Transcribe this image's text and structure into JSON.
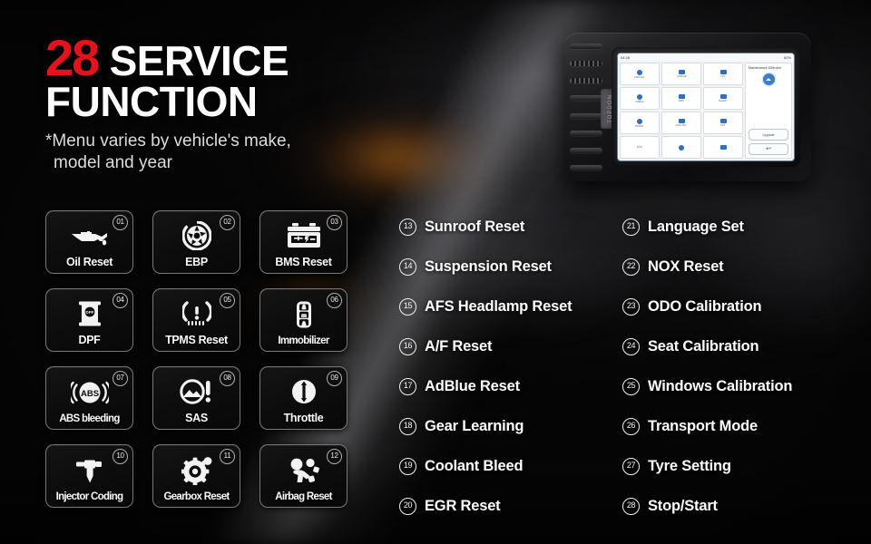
{
  "headline": {
    "count": "28",
    "title_part1": "SERVICE",
    "title_part2": "FUNCTION",
    "subtitle_line1": "*Menu varies by vehicle's make,",
    "subtitle_line2": "model and year",
    "accent_color": "#e4121a",
    "text_color": "#fdfdfd"
  },
  "cards": [
    {
      "num": "01",
      "label": "Oil Reset",
      "icon": "oil-can-icon"
    },
    {
      "num": "02",
      "label": "EBP",
      "icon": "brake-disc-icon"
    },
    {
      "num": "03",
      "label": "BMS Reset",
      "icon": "battery-icon"
    },
    {
      "num": "04",
      "label": "DPF",
      "icon": "dpf-filter-icon"
    },
    {
      "num": "05",
      "label": "TPMS Reset",
      "icon": "tire-pressure-icon"
    },
    {
      "num": "06",
      "label": "Immobilizer",
      "icon": "car-key-fob-icon"
    },
    {
      "num": "07",
      "label": "ABS bleeding",
      "icon": "abs-icon"
    },
    {
      "num": "08",
      "label": "SAS",
      "icon": "steering-angle-icon"
    },
    {
      "num": "09",
      "label": "Throttle",
      "icon": "throttle-icon"
    },
    {
      "num": "10",
      "label": "Injector Coding",
      "icon": "injector-icon"
    },
    {
      "num": "11",
      "label": "Gearbox Reset",
      "icon": "gear-icon"
    },
    {
      "num": "12",
      "label": "Airbag Reset",
      "icon": "airbag-icon"
    }
  ],
  "list_column_a": [
    {
      "num": "13",
      "label": "Sunroof Reset"
    },
    {
      "num": "14",
      "label": "Suspension Reset"
    },
    {
      "num": "15",
      "label": "AFS Headlamp Reset"
    },
    {
      "num": "16",
      "label": "A/F Reset"
    },
    {
      "num": "17",
      "label": "AdBlue Reset"
    },
    {
      "num": "18",
      "label": "Gear Learning"
    },
    {
      "num": "19",
      "label": "Coolant Bleed"
    },
    {
      "num": "20",
      "label": "EGR Reset"
    }
  ],
  "list_column_b": [
    {
      "num": "21",
      "label": "Language Set"
    },
    {
      "num": "22",
      "label": "NOX  Reset"
    },
    {
      "num": "23",
      "label": "ODO Calibration"
    },
    {
      "num": "24",
      "label": "Seat Calibration"
    },
    {
      "num": "25",
      "label": "Windows Calibration"
    },
    {
      "num": "26",
      "label": "Transport Mode"
    },
    {
      "num": "27",
      "label": "Tyre Setting"
    },
    {
      "num": "28",
      "label": "Stop/Start"
    }
  ],
  "device": {
    "brand": "TOPDON",
    "status_time": "04:28",
    "status_battery": "62%",
    "panel_title": "Maintenance\n&Service",
    "upgrade_label": "Upgrade",
    "back_label": "↩",
    "apps": [
      {
        "label": "AIRFUEL",
        "shape": "round"
      },
      {
        "label": "ADBLUE",
        "shape": "rect"
      },
      {
        "label": "AFS",
        "shape": "rect"
      },
      {
        "label": "AIRBAG",
        "shape": "round"
      },
      {
        "label": "BMS",
        "shape": "rect"
      },
      {
        "label": "BLEED",
        "shape": "rect"
      },
      {
        "label": "BRAKE",
        "shape": "round"
      },
      {
        "label": "COOLANT",
        "shape": "rect"
      },
      {
        "label": "DPF",
        "shape": "rect"
      },
      {
        "label": "EGR",
        "shape": "rect"
      },
      {
        "label": "",
        "shape": "round"
      },
      {
        "label": "",
        "shape": "rect"
      }
    ]
  }
}
